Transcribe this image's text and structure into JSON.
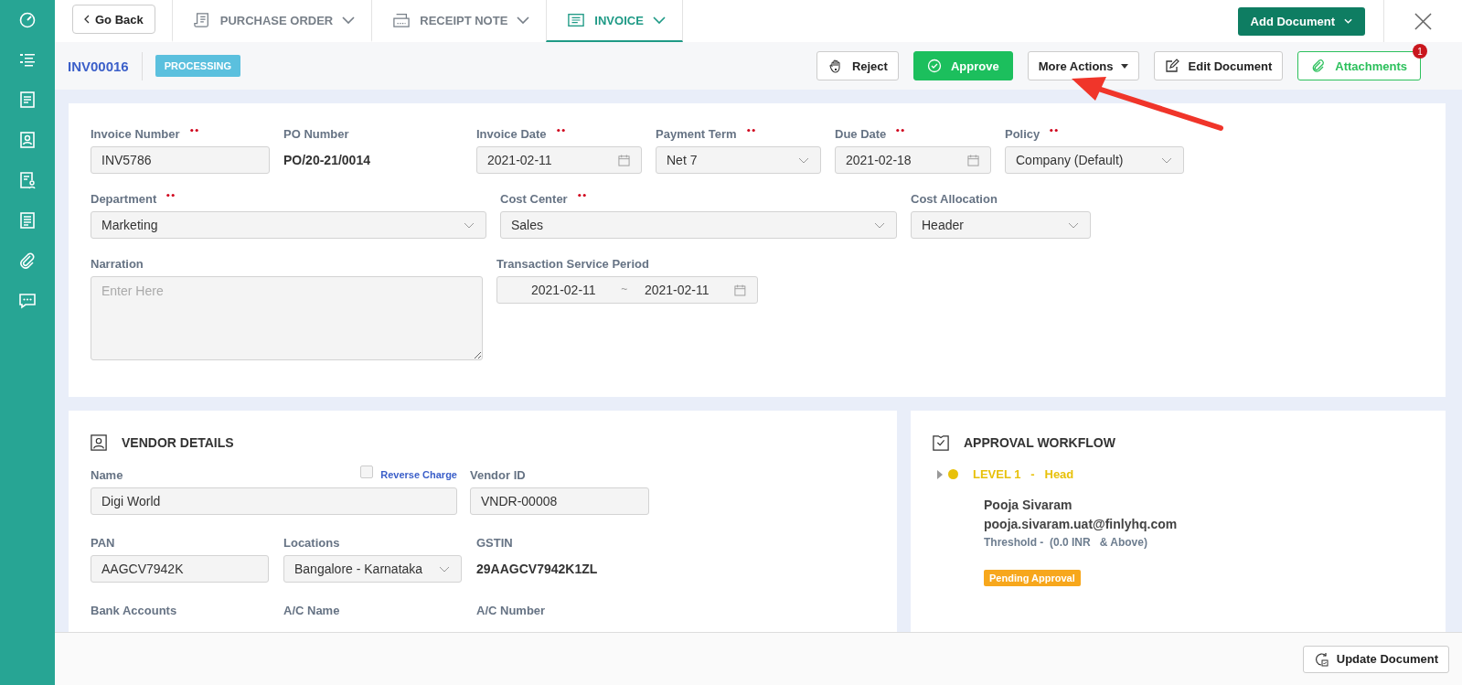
{
  "nav": {
    "back": "Go Back",
    "tabs": [
      {
        "label": "PURCHASE ORDER",
        "kind": "order",
        "selected": false
      },
      {
        "label": "RECEIPT NOTE",
        "kind": "receipt",
        "selected": false
      },
      {
        "label": "INVOICE",
        "kind": "invoice",
        "selected": true
      }
    ],
    "add_document": "Add Document"
  },
  "doc": {
    "number": "INV00016",
    "status": "PROCESSING",
    "actions": [
      {
        "label": "Reject",
        "kind": "reject"
      },
      {
        "label": "Approve",
        "kind": "approve"
      },
      {
        "label": "More Actions",
        "kind": "more"
      },
      {
        "label": "Edit Document",
        "kind": "edit"
      },
      {
        "label": "Attachments",
        "kind": "attach",
        "badge": "1"
      }
    ]
  },
  "form": {
    "rows": [
      {
        "fields": [
          {
            "label": "Invoice Number",
            "required": true,
            "kind": "input",
            "value": "INV5786"
          },
          {
            "label": "PO Number",
            "required": false,
            "kind": "text",
            "value": "PO/20-21/0014"
          },
          {
            "label": "Invoice Date",
            "required": true,
            "kind": "date",
            "value": "2021-02-11"
          },
          {
            "label": "Payment Term",
            "required": true,
            "kind": "select",
            "value": "Net 7"
          },
          {
            "label": "Due Date",
            "required": true,
            "kind": "date",
            "value": "2021-02-18"
          },
          {
            "label": "Policy",
            "required": true,
            "kind": "select",
            "value": "Company (Default)"
          }
        ]
      },
      {
        "fields": [
          {
            "label": "Department",
            "required": true,
            "kind": "select",
            "value": "Marketing"
          },
          {
            "label": "Cost Center",
            "required": true,
            "kind": "select",
            "value": "Sales"
          },
          {
            "label": "Cost Allocation",
            "required": false,
            "kind": "select",
            "value": "Header"
          }
        ]
      },
      {
        "fields": [
          {
            "label": "Narration",
            "required": false,
            "kind": "textarea",
            "placeholder": "Enter Here"
          },
          {
            "label": "Transaction Service Period",
            "required": false,
            "kind": "range",
            "from": "2021-02-11",
            "separator": "~",
            "to": "2021-02-11"
          }
        ]
      }
    ]
  },
  "vendor": {
    "title": "VENDOR DETAILS",
    "reverse_charge": {
      "label": "Reverse Charge",
      "checked": false
    },
    "rows": [
      {
        "fields": [
          {
            "label": "Name",
            "required": false,
            "kind": "input",
            "value": "Digi World"
          },
          {
            "label": "Vendor ID",
            "required": false,
            "kind": "input",
            "value": "VNDR-00008"
          }
        ]
      },
      {
        "fields": [
          {
            "label": "PAN",
            "required": false,
            "kind": "input",
            "value": "AAGCV7942K"
          },
          {
            "label": "Locations",
            "required": false,
            "kind": "select",
            "value": "Bangalore - Karnataka"
          },
          {
            "label": "GSTIN",
            "required": false,
            "kind": "text",
            "value": "29AAGCV7942K1ZL"
          }
        ]
      },
      {
        "fields": [
          {
            "label": "Bank Accounts",
            "required": false,
            "kind": "label"
          },
          {
            "label": "A/C Name",
            "required": false,
            "kind": "label"
          },
          {
            "label": "A/C Number",
            "required": false,
            "kind": "label"
          }
        ]
      }
    ]
  },
  "approval": {
    "title": "APPROVAL WORKFLOW",
    "levels": [
      {
        "label": "LEVEL 1   -   Head",
        "color": "#e8c10a",
        "expanded": false,
        "name": "Pooja Sivaram",
        "email": "pooja.sivaram.uat@finlyhq.com",
        "threshold": "Threshold -  (0.0 INR   & Above)",
        "status": "Pending Approval"
      }
    ]
  },
  "footer": {
    "update": "Update Document"
  }
}
